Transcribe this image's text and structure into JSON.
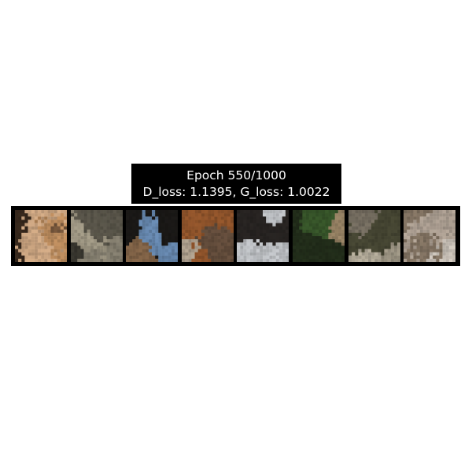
{
  "figure": {
    "title_line1": "Epoch 550/1000",
    "title_line2": "D_loss: 1.1395, G_loss: 1.0022"
  },
  "samples": [
    {
      "name": "sample-1",
      "palette": [
        "#7b5a3e",
        "#c89564",
        "#3a2a1e",
        "#d9b08a"
      ]
    },
    {
      "name": "sample-2",
      "palette": [
        "#5e5a4e",
        "#8a8474",
        "#3c3a32",
        "#a9a18c"
      ]
    },
    {
      "name": "sample-3",
      "palette": [
        "#e9eef2",
        "#1c1a18",
        "#6c8fb8",
        "#8a6a4c"
      ]
    },
    {
      "name": "sample-4",
      "palette": [
        "#6a5240",
        "#b8a996",
        "#2e241c",
        "#9a5a2e"
      ]
    },
    {
      "name": "sample-5",
      "palette": [
        "#c9ccd0",
        "#2a2624",
        "#8c8a86",
        "#e6e6e8"
      ]
    },
    {
      "name": "sample-6",
      "palette": [
        "#3a5a2c",
        "#6a8a3e",
        "#24301c",
        "#a08a6a"
      ]
    },
    {
      "name": "sample-7",
      "palette": [
        "#7c7466",
        "#a49c8a",
        "#4a4a36",
        "#bdb5a2"
      ]
    },
    {
      "name": "sample-8",
      "palette": [
        "#b8aa9c",
        "#d6cec4",
        "#8a7a68",
        "#a47a66"
      ]
    }
  ],
  "colors": {
    "background": "#ffffff",
    "frame": "#000000",
    "title_text": "#ffffff"
  }
}
